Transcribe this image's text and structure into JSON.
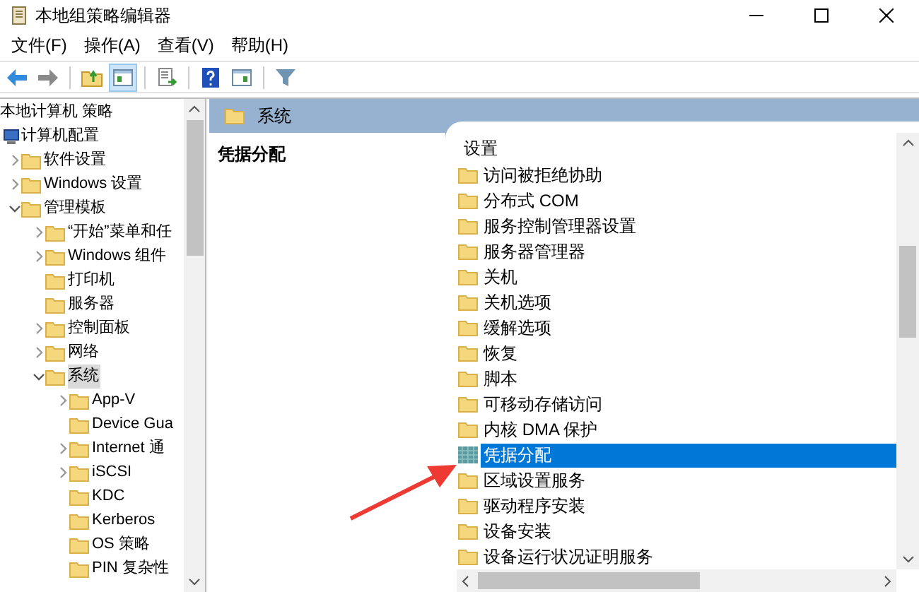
{
  "window": {
    "title": "本地组策略编辑器"
  },
  "menu": [
    {
      "label": "文件(F)"
    },
    {
      "label": "操作(A)"
    },
    {
      "label": "查看(V)"
    },
    {
      "label": "帮助(H)"
    }
  ],
  "toolbar": {
    "tree_toggle_on": true
  },
  "tree": {
    "label": "本地计算机 策略",
    "selected": false,
    "children": [
      {
        "label": "计算机配置",
        "selected": false,
        "expandable": false,
        "kind": "computer",
        "children": [
          {
            "label": "软件设置",
            "selected": false,
            "expandable": true,
            "expanded": false
          },
          {
            "label": "Windows 设置",
            "selected": false,
            "expandable": true,
            "expanded": false
          },
          {
            "label": "管理模板",
            "selected": false,
            "expandable": true,
            "expanded": true,
            "children": [
              {
                "label": "“开始”菜单和任",
                "selected": false,
                "expandable": true,
                "expanded": false
              },
              {
                "label": "Windows 组件",
                "selected": false,
                "expandable": true,
                "expanded": false
              },
              {
                "label": "打印机",
                "selected": false,
                "expandable": false
              },
              {
                "label": "服务器",
                "selected": false,
                "expandable": false
              },
              {
                "label": "控制面板",
                "selected": false,
                "expandable": true,
                "expanded": false
              },
              {
                "label": "网络",
                "selected": false,
                "expandable": true,
                "expanded": false
              },
              {
                "label": "系统",
                "selected": true,
                "expandable": true,
                "expanded": true,
                "children": [
                  {
                    "label": "App-V",
                    "selected": false,
                    "expandable": true,
                    "expanded": false
                  },
                  {
                    "label": "Device Gua",
                    "selected": false,
                    "expandable": false
                  },
                  {
                    "label": "Internet 通",
                    "selected": false,
                    "expandable": true,
                    "expanded": false
                  },
                  {
                    "label": "iSCSI",
                    "selected": false,
                    "expandable": true,
                    "expanded": false
                  },
                  {
                    "label": "KDC",
                    "selected": false,
                    "expandable": false
                  },
                  {
                    "label": "Kerberos",
                    "selected": false,
                    "expandable": false
                  },
                  {
                    "label": "OS 策略",
                    "selected": false,
                    "expandable": false
                  },
                  {
                    "label": "PIN 复杂性",
                    "selected": false,
                    "expandable": false
                  }
                ]
              }
            ]
          }
        ]
      }
    ]
  },
  "header": {
    "title": "系统"
  },
  "description": {
    "title": "凭据分配"
  },
  "list": {
    "column": "设置",
    "items": [
      {
        "label": "访问被拒绝协助",
        "selected": false
      },
      {
        "label": "分布式 COM",
        "selected": false
      },
      {
        "label": "服务控制管理器设置",
        "selected": false
      },
      {
        "label": "服务器管理器",
        "selected": false
      },
      {
        "label": "关机",
        "selected": false
      },
      {
        "label": "关机选项",
        "selected": false
      },
      {
        "label": "缓解选项",
        "selected": false
      },
      {
        "label": "恢复",
        "selected": false
      },
      {
        "label": "脚本",
        "selected": false
      },
      {
        "label": "可移动存储访问",
        "selected": false
      },
      {
        "label": "内核 DMA 保护",
        "selected": false
      },
      {
        "label": "凭据分配",
        "selected": true
      },
      {
        "label": "区域设置服务",
        "selected": false
      },
      {
        "label": "驱动程序安装",
        "selected": false
      },
      {
        "label": "设备安装",
        "selected": false
      },
      {
        "label": "设备运行状况证明服务",
        "selected": false
      }
    ]
  }
}
